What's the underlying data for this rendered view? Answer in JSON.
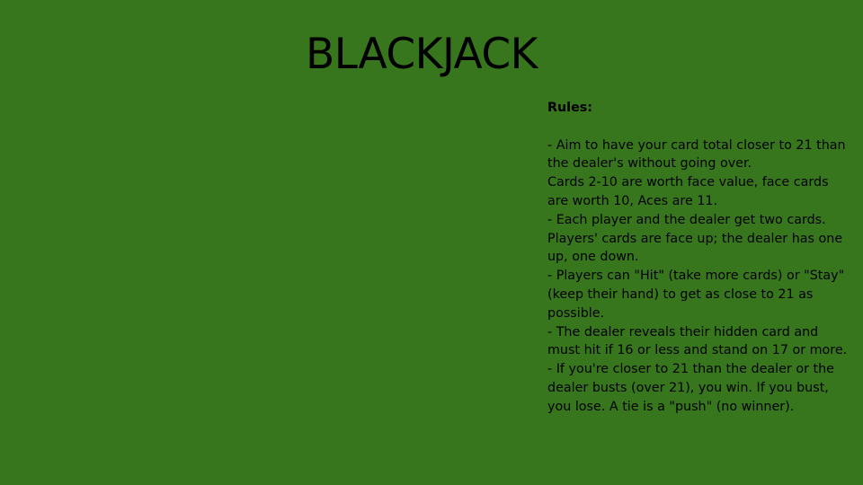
{
  "colors": {
    "table_felt": "#37761d",
    "text": "#000000"
  },
  "title": "BLACKJACK",
  "rules": {
    "heading": "Rules:",
    "lines": [
      "- Aim to have your card total closer to 21 than the dealer's without going over.",
      "Cards 2-10 are worth face value, face cards are worth 10, Aces are 11.",
      "- Each player and the dealer get two cards. Players' cards are face up; the dealer has one up, one down.",
      "- Players can \"Hit\" (take more cards) or \"Stay\" (keep their hand) to get as close to 21 as possible.",
      "- The dealer reveals their hidden card and must hit if 16 or less and stand on 17 or more.",
      "- If you're closer to 21 than the dealer or the dealer busts (over 21), you win. If you bust, you lose. A tie is a \"push\" (no winner)."
    ]
  }
}
